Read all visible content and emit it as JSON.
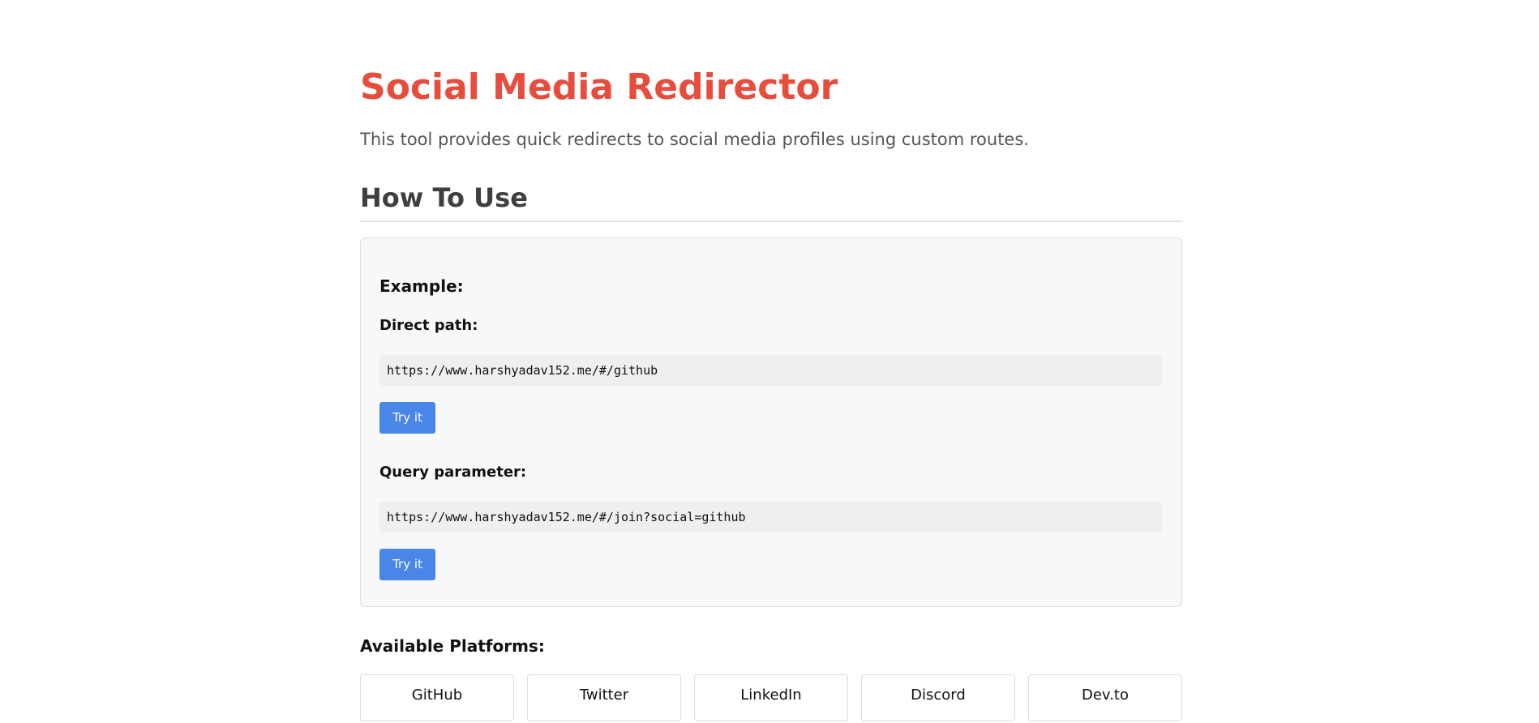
{
  "page": {
    "title": "Social Media Redirector",
    "intro": "This tool provides quick redirects to social media profiles using custom routes."
  },
  "how_to_use": {
    "heading": "How To Use",
    "example_heading": "Example:",
    "direct": {
      "label": "Direct path:",
      "url": "https://www.harshyadav152.me/#/github",
      "button_label": "Try it"
    },
    "query": {
      "label": "Query parameter:",
      "url": "https://www.harshyadav152.me/#/join?social=github",
      "button_label": "Try it"
    }
  },
  "platforms": {
    "heading": "Available Platforms:",
    "items": [
      {
        "label": "GitHub"
      },
      {
        "label": "Twitter"
      },
      {
        "label": "LinkedIn"
      },
      {
        "label": "Discord"
      },
      {
        "label": "Dev.to"
      }
    ]
  },
  "colors": {
    "title": "#e74c3c",
    "button": "#4a86e8",
    "box_background": "#f8f8f8",
    "code_background": "#efefef"
  }
}
